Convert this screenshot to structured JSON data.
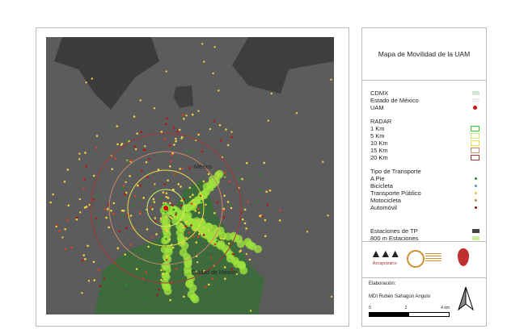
{
  "title": "Mapa de Movilidad de la UAM",
  "map_labels": {
    "city": "México",
    "cdmx": "Ciudad de México"
  },
  "legend": {
    "areas": [
      {
        "label": "CDMX",
        "color": "#cfe8cf"
      },
      {
        "label": "Estado de México",
        "color": "#eeeeee"
      },
      {
        "label": "UAM",
        "color": "#cc1111",
        "icon": "uam-marker-icon"
      }
    ],
    "radar_title": "RADAR",
    "radar": [
      {
        "label": "1 Km",
        "color": "#33cc33"
      },
      {
        "label": "5 Km",
        "color": "#ccee66"
      },
      {
        "label": "10 Km",
        "color": "#eedd44"
      },
      {
        "label": "15 Km",
        "color": "#cc8866"
      },
      {
        "label": "20 Km",
        "color": "#aa3333"
      }
    ],
    "transport_title": "Tipo de Transporte",
    "transport": [
      {
        "label": "A Pie",
        "color": "#2a8a2a"
      },
      {
        "label": "Bicicleta",
        "color": "#4a9a9a"
      },
      {
        "label": "Transporte Público",
        "color": "#f0c040"
      },
      {
        "label": "Motocicleta",
        "color": "#d08040"
      },
      {
        "label": "Automóvil",
        "color": "#8a1010"
      }
    ],
    "stations": [
      {
        "label": "Estaciones de TP",
        "color": "#444444"
      },
      {
        "label": "800 m Estaciones",
        "color": "#ccf0a0"
      }
    ]
  },
  "logos": {
    "uam": "Azcapotzalco"
  },
  "credits": {
    "heading": "Elaboración:",
    "author": "MDI Rubén Sahagún Angulo"
  },
  "scale": {
    "ticks": [
      "0",
      "2",
      "4 km"
    ]
  },
  "north_arrow": "north-arrow-icon"
}
